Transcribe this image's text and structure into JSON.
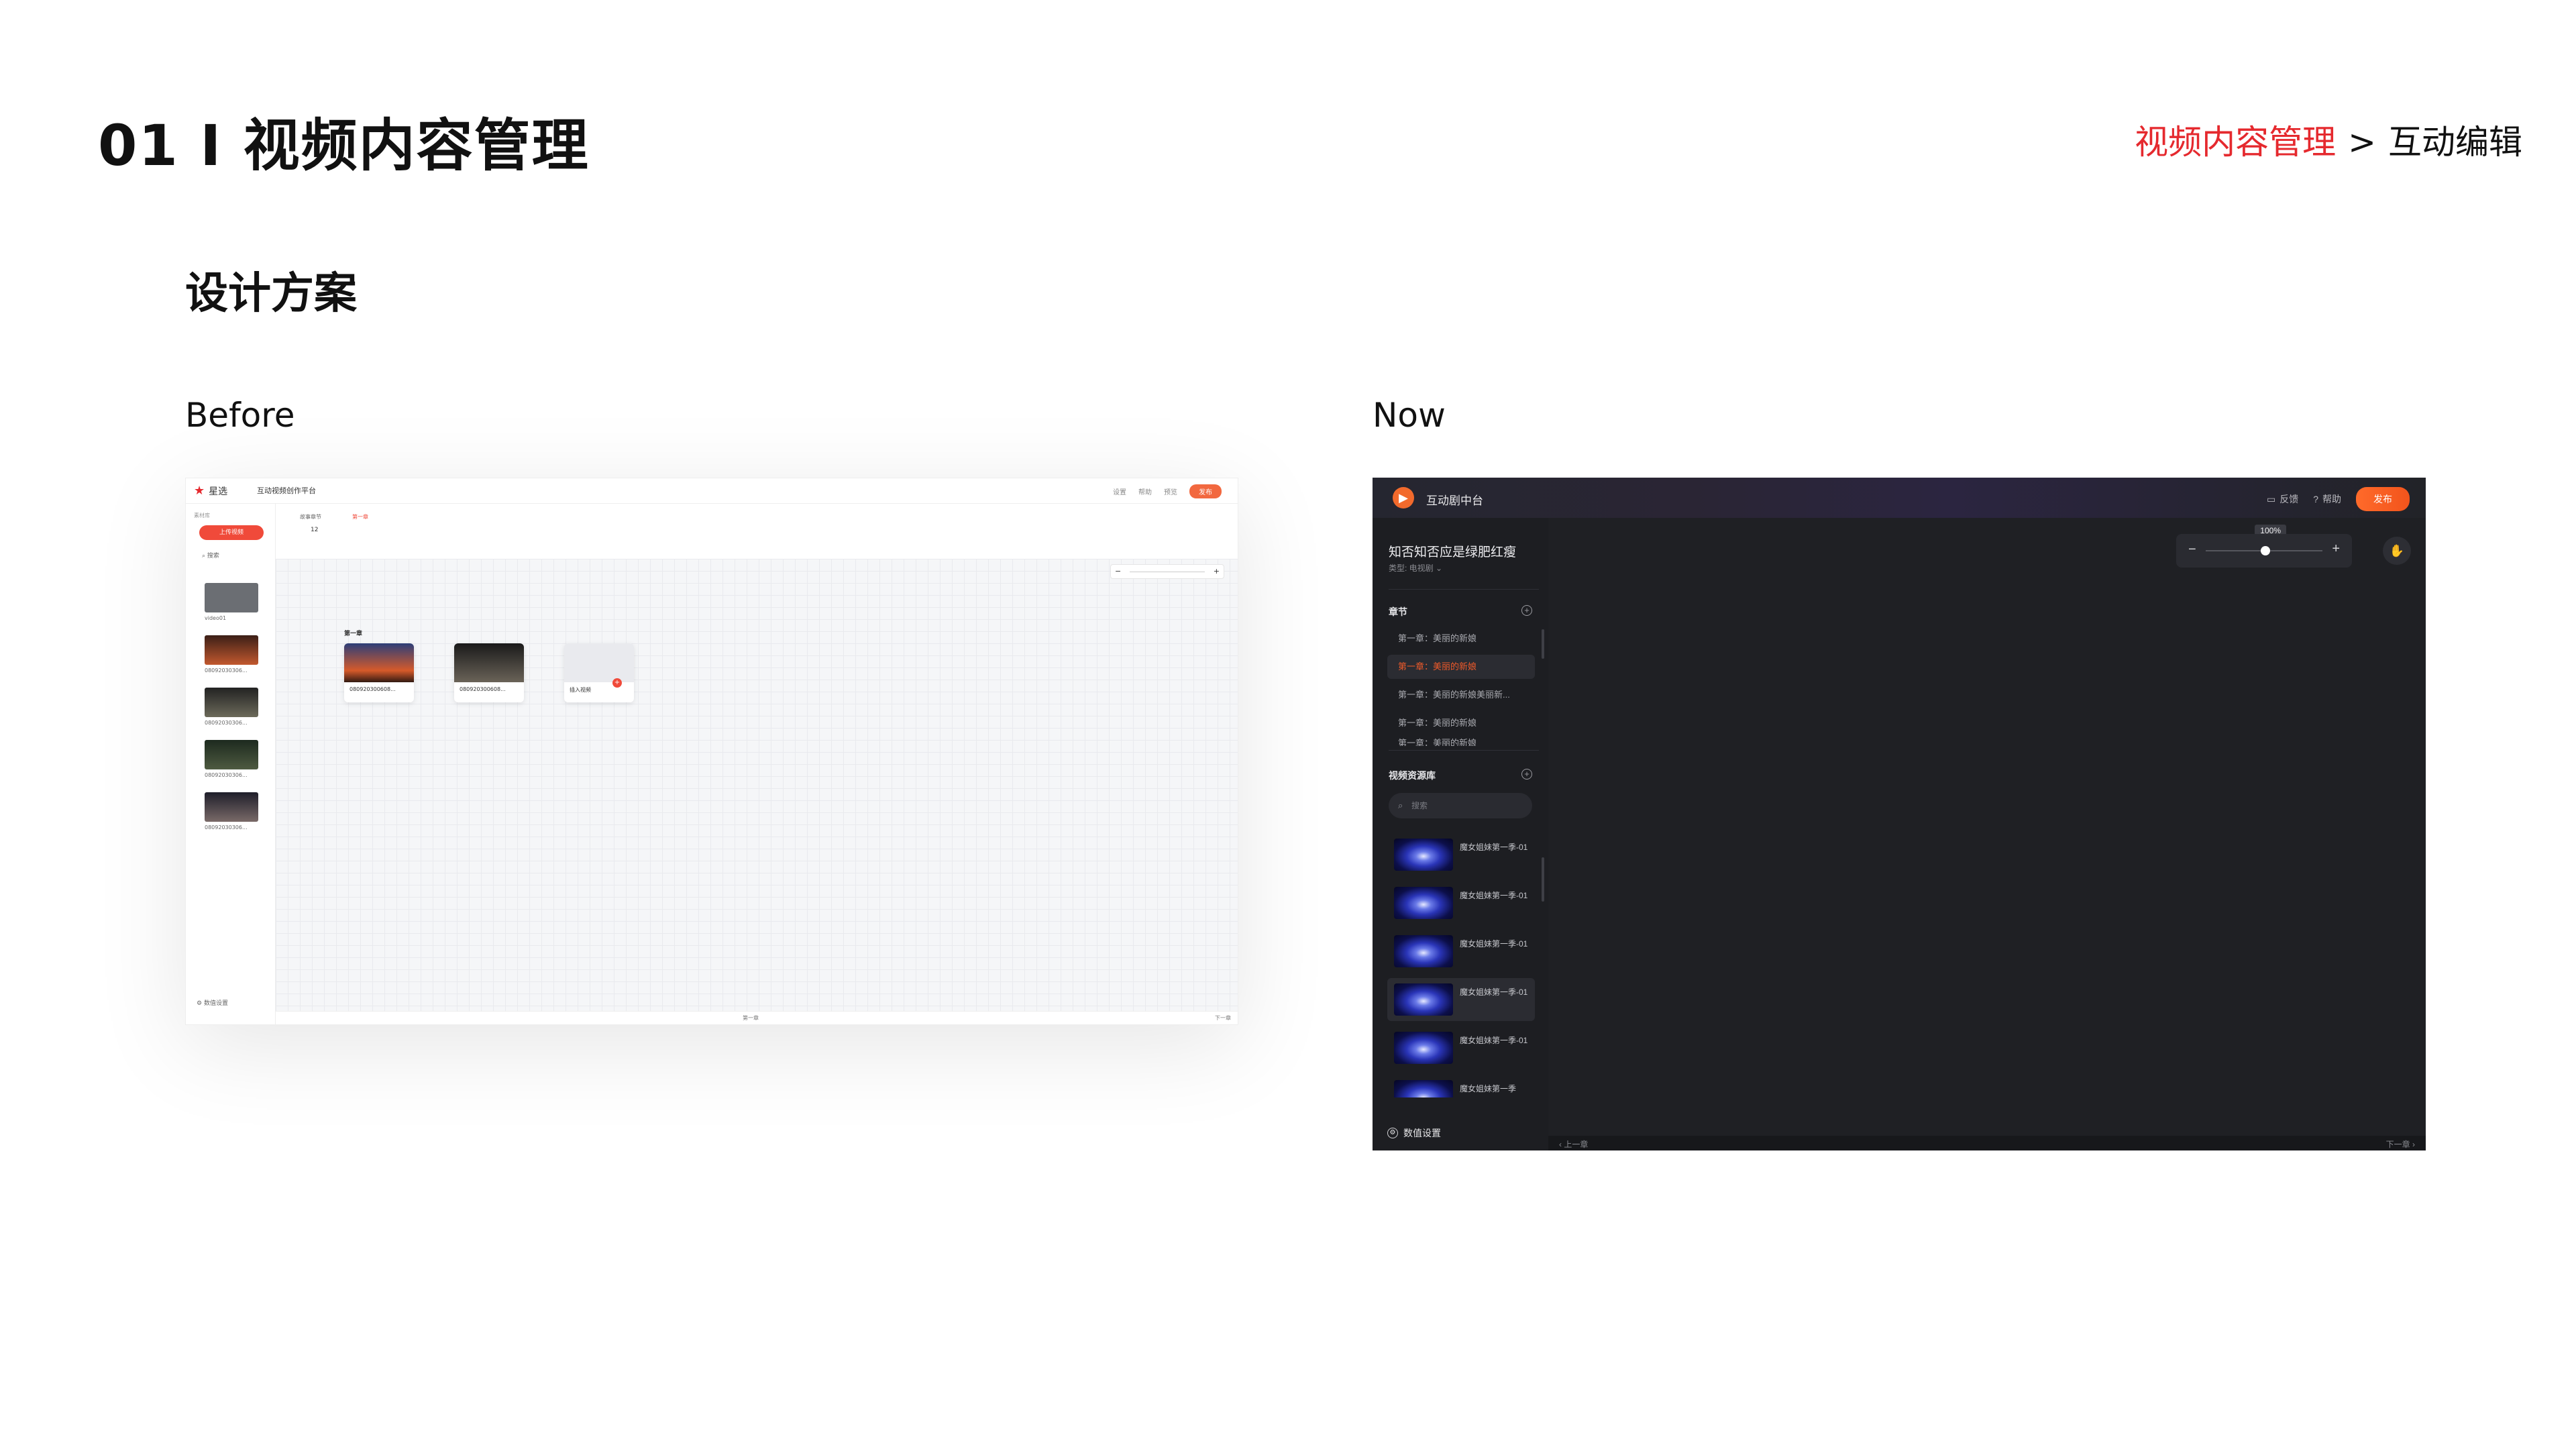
{
  "page": {
    "title": "01 I 视频内容管理",
    "subtitle": "设计方案",
    "breadcrumb": {
      "section": "视频内容管理",
      "separator": ">",
      "current": "互动编辑"
    },
    "label_before": "Before",
    "label_now": "Now"
  },
  "before": {
    "logo_text": "星选",
    "app_title": "互动视频创作平台",
    "top_links": [
      "设置",
      "帮助",
      "预览"
    ],
    "publish": "发布",
    "sidebar_label": "素材库",
    "upload_button": "上传视频",
    "search_label": "搜索",
    "thumbs": [
      "video01",
      "08092030306...",
      "08092030306...",
      "08092030306...",
      "08092030306..."
    ],
    "sidebar_footer": "数值设置",
    "panel_tab1": "故事章节",
    "panel_count": "12",
    "panel_tab2": "第一章",
    "chapter_label": "第一章",
    "cards": [
      "080920300608...",
      "080920300608...",
      "插入视频"
    ],
    "footer_left": "第一章",
    "footer_right": "下一章"
  },
  "now": {
    "app_title": "互动剧中台",
    "feedback": "反馈",
    "help": "帮助",
    "publish": "发布",
    "project_title": "知否知否应是绿肥红瘦",
    "project_type": "类型: 电视剧",
    "chapters_title": "章节",
    "chapters": [
      "第一章：美丽的新娘",
      "第一章：美丽的新娘",
      "第一章：美丽的新娘美丽新...",
      "第一章：美丽的新娘",
      "第一章：美丽的新娘"
    ],
    "library_title": "视频资源库",
    "search_placeholder": "搜索",
    "videos": [
      "魔女姐妹第一季-01",
      "魔女姐妹第一季-01",
      "魔女姐妹第一季-01",
      "魔女姐妹第一季-01",
      "魔女姐妹第一季-01",
      "魔女姐妹第一季"
    ],
    "settings": "数值设置",
    "zoom_value": "100%",
    "footer_prev": "上一章",
    "footer_next": "下一章",
    "accent": "#ef5a2a"
  }
}
